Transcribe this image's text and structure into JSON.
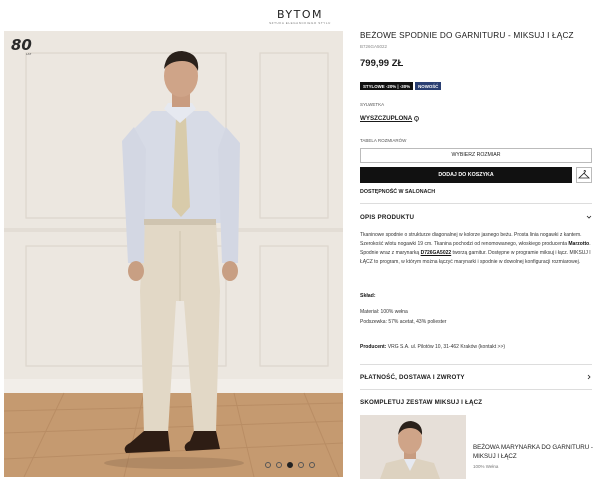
{
  "header": {
    "brand": "BYTOM",
    "tagline": "SZTUKA ELEGANCKIEGO STYLU"
  },
  "gallery": {
    "badge": "80",
    "badge_sub": "LAT",
    "dots": [
      false,
      false,
      true,
      false,
      false
    ]
  },
  "product": {
    "title": "BEŻOWE SPODNIE DO GARNITURU - MIKSUJ I ŁĄCZ",
    "sku": "B726GA5022",
    "price": "799,99 ZŁ",
    "tags": [
      "STYLOWE -20% | -30%",
      "NOWOŚĆ"
    ],
    "fit_label": "SYLWETKA",
    "fit_value": "WYSZCZUPLONA",
    "size_table_label": "TABELA ROZMIARÓW",
    "size_button": "WYBIERZ ROZMIAR",
    "cart_button": "DODAJ DO KOSZYKA",
    "availability": "DOSTĘPNOŚĆ W SALONACH"
  },
  "description": {
    "title": "OPIS PRODUKTU",
    "p1": "Tkaninowe spodnie o strukturze diagonalnej w kolorze jasnego beżu. Prosta linia nogawki z kantem. Szerokość wlotu nogawki 19 cm. Tkanina pochodzi od renomowanego, włoskiego producenta ",
    "brand_name": "Marzotto",
    "p2": ". Spodnie wraz z marynarką ",
    "linked_sku": "D726GA5022",
    "p3": " tworzą garnitur. Dostępne w programie miksuj i łącz. MIKSUJ I ŁĄCZ to program, w którym można łączyć marynarki i spodnie w dowolnej konfiguracji rozmiarowej.",
    "composition_label": "Skład:",
    "material": "Materiał: 100% wełna",
    "lining": "Podszewka: 57% acetat, 43% poliester",
    "producer_label": "Producent:",
    "producer": " VRG S.A. ul. Pilotów 10, 31-462 Kraków (kontakt >>)"
  },
  "sections": {
    "payment": "PŁATNOŚĆ, DOSTAWA I ZWROTY",
    "complete_set": "SKOMPLETUJ ZESTAW MIKSUJ I ŁĄCZ"
  },
  "related": {
    "name": "BEŻOWA MARYNARKA DO GARNITURU - MIKSUJ I ŁĄCZ",
    "material": "100% Wełna"
  }
}
